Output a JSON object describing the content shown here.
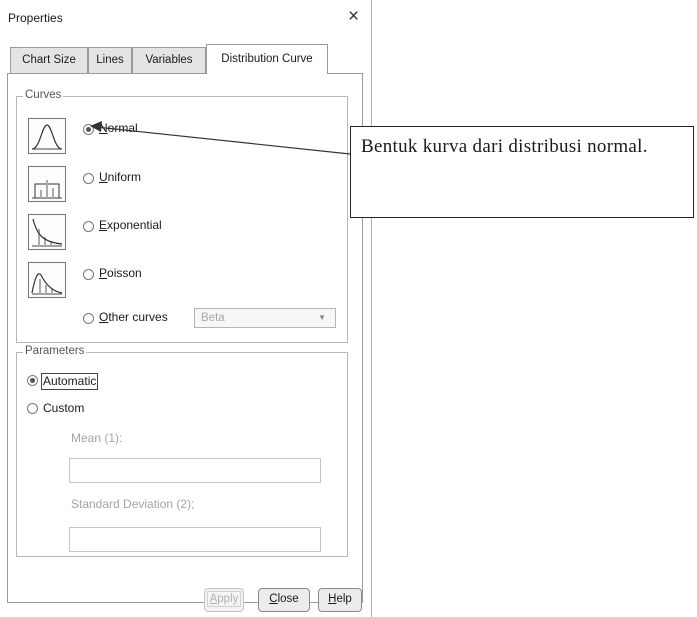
{
  "window": {
    "title": "Properties",
    "close_glyph": "×"
  },
  "tabs": [
    {
      "label": "Chart Size",
      "active": false
    },
    {
      "label": "Lines",
      "active": false
    },
    {
      "label": "Variables",
      "active": false
    },
    {
      "label": "Distribution Curve",
      "active": true
    }
  ],
  "curves": {
    "legend": "Curves",
    "options": [
      {
        "label": "Normal",
        "icon": "normal-curve-icon",
        "selected": true
      },
      {
        "label": "Uniform",
        "icon": "uniform-curve-icon",
        "selected": false
      },
      {
        "label": "Exponential",
        "icon": "exponential-curve-icon",
        "selected": false
      },
      {
        "label": "Poisson",
        "icon": "poisson-curve-icon",
        "selected": false
      },
      {
        "label": "Other curves",
        "selected": false
      }
    ],
    "other_select_value": "Beta"
  },
  "parameters": {
    "legend": "Parameters",
    "automatic_label": "Automatic",
    "custom_label": "Custom",
    "selected": "Automatic",
    "mean_label": "Mean (1):",
    "mean_value": "",
    "sd_label": "Standard Deviation (2);",
    "sd_value": ""
  },
  "buttons": {
    "apply": "Apply",
    "close": "Close",
    "help": "Help"
  },
  "annotation": {
    "text": "Bentuk kurva dari distribusi normal."
  },
  "colors": {
    "panel_border": "#9a9a9a",
    "disabled_text": "#a4a4a4",
    "callout_border": "#222222"
  }
}
